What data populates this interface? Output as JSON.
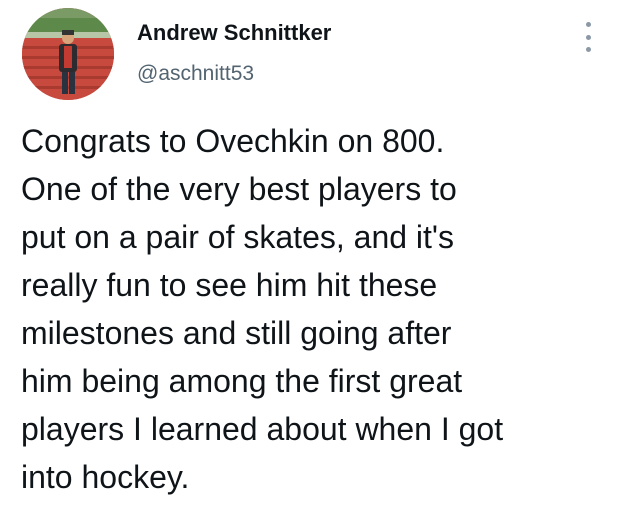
{
  "tweet": {
    "author_name": "Andrew Schnittker",
    "author_handle": "@aschnitt53",
    "avatar_icon": "profile-photo",
    "more_icon": "more-options-icon",
    "text_lines": [
      "Congrats to Ovechkin on 800.",
      "One of the very best players to",
      "put on a pair of skates, and it's",
      "really fun to see him hit these",
      "milestones and still going after",
      "him being among the first great",
      "players I learned about when I got",
      "into hockey."
    ]
  },
  "colors": {
    "text": "#0f1419",
    "secondary": "#536471",
    "avatar_red": "#c4463b"
  }
}
